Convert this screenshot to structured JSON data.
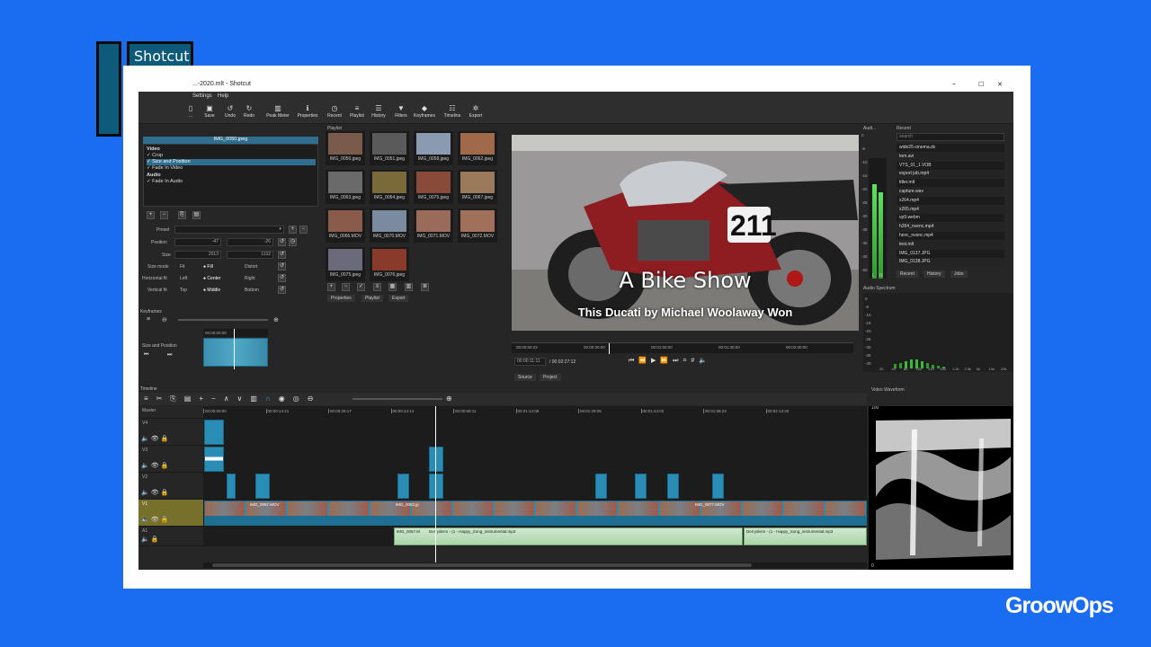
{
  "brand": {
    "logo_text": "Shotcut",
    "watermark": "GroowOps"
  },
  "window": {
    "title": "...-2020.mlt - Shotcut",
    "controls": [
      "–",
      "☐",
      "✕"
    ]
  },
  "menu": [
    "Settings",
    "Help"
  ],
  "toolbar": [
    {
      "label": "...",
      "icon": "folder-icon"
    },
    {
      "label": "Save",
      "icon": "save-icon"
    },
    {
      "label": "Undo",
      "icon": "undo-icon"
    },
    {
      "label": "Redo",
      "icon": "redo-icon"
    },
    {
      "label": "Peak Meter",
      "icon": "meter-icon"
    },
    {
      "label": "Properties",
      "icon": "info-icon"
    },
    {
      "label": "Recent",
      "icon": "clock-icon"
    },
    {
      "label": "Playlist",
      "icon": "list-icon"
    },
    {
      "label": "History",
      "icon": "history-icon"
    },
    {
      "label": "Filters",
      "icon": "filter-icon"
    },
    {
      "label": "Keyframes",
      "icon": "keyframe-icon"
    },
    {
      "label": "Timeline",
      "icon": "timeline-icon"
    },
    {
      "label": "Export",
      "icon": "export-icon"
    }
  ],
  "filters_panel": {
    "clip_name": "IMG_0050.jpeg",
    "items": [
      {
        "text": "Video",
        "header": true
      },
      {
        "text": "✓ Crop"
      },
      {
        "text": "✓ Size and Position",
        "selected": true
      },
      {
        "text": "✓ Fade In Video"
      },
      {
        "text": "Audio",
        "header": true
      },
      {
        "text": "✓ Fade In Audio"
      }
    ],
    "preset_label": "Preset",
    "position_label": "Position",
    "position_x": "-47",
    "position_y": "-26",
    "size_label": "Size",
    "size_w": "2013",
    "size_h": "1132",
    "size_mode_label": "Size mode",
    "size_modes": [
      "Fit",
      "Fill",
      "Distort"
    ],
    "hfit_label": "Horizontal fit",
    "hfit": [
      "Left",
      "Center",
      "Right"
    ],
    "vfit_label": "Vertical fit",
    "vfit": [
      "Top",
      "Middle",
      "Bottom"
    ]
  },
  "playlist": {
    "title": "Playlist",
    "items": [
      {
        "caption": "IMG_0050.jpeg",
        "color": "#7a5a4a"
      },
      {
        "caption": "IMG_0051.jpeg",
        "color": "#5a5a5a"
      },
      {
        "caption": "IMG_0058.jpeg",
        "color": "#8a9ab0"
      },
      {
        "caption": "IMG_0062.jpeg",
        "color": "#a06a4a"
      },
      {
        "caption": "IMG_0063.jpeg",
        "color": "#6a6a6a"
      },
      {
        "caption": "IMG_0064.jpeg",
        "color": "#7a6a3a"
      },
      {
        "caption": "IMG_0075.jpeg",
        "color": "#8a4a3a"
      },
      {
        "caption": "IMG_0067.jpeg",
        "color": "#9a7a5a"
      },
      {
        "caption": "IMG_0066.MOV",
        "color": "#8a5a4a"
      },
      {
        "caption": "IMG_0070.MOV",
        "color": "#7a8aa0"
      },
      {
        "caption": "IMG_0071.MOV",
        "color": "#9a6a5a"
      },
      {
        "caption": "IMG_0072.MOV",
        "color": "#a0705a"
      },
      {
        "caption": "IMG_0075.jpeg",
        "color": "#6a6a7a"
      },
      {
        "caption": "IMG_0076.jpeg",
        "color": "#8a3a2a"
      }
    ],
    "tabs": [
      "Properties",
      "Playlist",
      "Export"
    ]
  },
  "keyframes": {
    "title": "Keyframes",
    "track": "Size and Position",
    "timecode": "00:00:00:00"
  },
  "viewer": {
    "overlay_title": "A Bike Show",
    "overlay_subtitle": "This Ducati by Michael Woolaway Won",
    "race_number": "211",
    "ruler_marks": [
      "00:00:00:22",
      "00:00:30:00",
      "00:01:00:00",
      "00:01:30:00",
      "00:02:00:00"
    ],
    "current_time": "00:00:11:11",
    "total_time": "/ 00:02:27:12",
    "tabs": [
      "Source",
      "Project"
    ]
  },
  "audio_meter": {
    "title": "Audi...",
    "scale": [
      "0",
      "-5",
      "-10",
      "-15",
      "-20",
      "-25",
      "-30",
      "-35",
      "-40",
      "-45",
      "-50"
    ],
    "channels": [
      "L",
      "R"
    ],
    "levels": [
      0.78,
      0.72
    ]
  },
  "recent": {
    "title": "Recent",
    "search_placeholder": "search",
    "items": [
      "wide25-cinema.dv",
      "tom.avi",
      "VTS_01_1.VOB",
      "export job.mp4",
      "titler.mlt",
      "capture.wav",
      "x264.mp4",
      "x265.mp4",
      "vp9.webm",
      "h264_nvenc.mp4",
      "hevc_nvenc.mp4",
      "test.mlt",
      "IMG_0137.JPG",
      "IMG_0138.JPG"
    ],
    "tabs": [
      "Recent",
      "History",
      "Jobs"
    ]
  },
  "audio_spectrum": {
    "title": "Audio Spectrum",
    "scale": [
      "0",
      "-5",
      "-10",
      "-15",
      "-20",
      "-25",
      "-30",
      "-35",
      "-40"
    ],
    "freq_labels": [
      "20",
      "40",
      "80",
      "160",
      "315",
      "630",
      "1.2k",
      "2.5k",
      "5k",
      "10k",
      "20k"
    ]
  },
  "timeline": {
    "title": "Timeline",
    "master_label": "Master",
    "time_marks": [
      "00:00:00:00",
      "00:00:14:21",
      "00:00:29:17",
      "00:00:44:14",
      "00:00:59:11",
      "00:01:14:08",
      "00:01:29:05",
      "00:01:44:02",
      "00:01:58:23",
      "00:02:13:20"
    ],
    "tracks": [
      "V4",
      "V3",
      "V2",
      "V1",
      "A1"
    ],
    "clip_labels": [
      "IMG_0057.MOV",
      "IMG_0052.jp",
      "IMG_0077.MOV"
    ],
    "audio_labels": [
      "IMG_0057.M",
      "Derryderm - (1 - Happy_Song_instrumental.mp3",
      "Derryderm - (1 - Happy_Song_instrumental.mp3"
    ]
  },
  "video_waveform": {
    "title": "Video Waveform",
    "scale_top": "100",
    "scale_bottom": "0"
  },
  "colors": {
    "accent": "#2a8db6",
    "background": "#1a6cf0",
    "panel": "#262626"
  }
}
